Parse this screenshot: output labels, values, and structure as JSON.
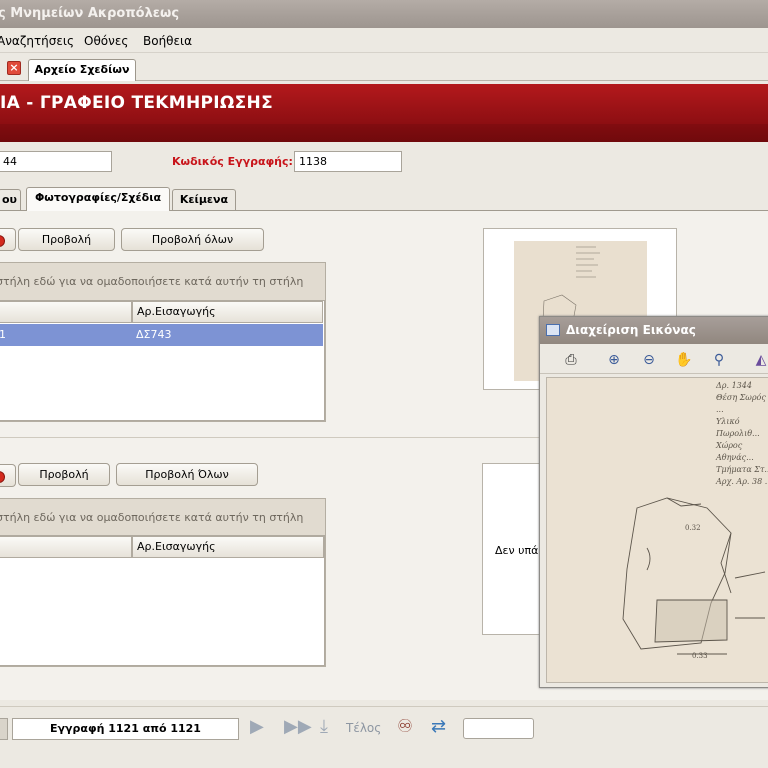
{
  "window": {
    "title": "ς Μνημείων Ακροπόλεως"
  },
  "menu": {
    "items": [
      "Αναζητήσεις",
      "Οθόνες",
      "Βοήθεια"
    ]
  },
  "doc_tab": {
    "label": "Αρχείο Σχεδίων"
  },
  "banner": {
    "title": "ΙΑ - ΓΡΑΦΕΙΟ ΤΕΚΜΗΡΙΩΣΗΣ"
  },
  "record": {
    "left_value": "44",
    "code_label": "Κωδικός Εγγραφής:",
    "code_value": "1138"
  },
  "tabs": [
    "ου",
    "Φωτογραφίες/Σχέδια",
    "Κείμενα"
  ],
  "photos": {
    "view_label": "Προβολή",
    "view_all_label": "Προβολή όλων",
    "group_hint": "στήλη εδώ για να ομαδοποιήσετε κατά αυτήν τη στήλη",
    "col_header": "Αρ.Εισαγωγής",
    "row_left": "1",
    "row_value": "ΔΣ743"
  },
  "drawings": {
    "view_label": "Προβολή",
    "view_all_label": "Προβολή Όλων",
    "group_hint": "στήλη εδώ για να ομαδοποιήσετε κατά αυτήν τη στήλη",
    "col_header": "Αρ.Εισαγωγής",
    "no_image_text": "Δεν υπάρ"
  },
  "navigator": {
    "record_text": "Εγγραφή 1121 από 1121",
    "end_label": "Τέλος"
  },
  "image_window": {
    "title": "Διαχείριση Εικόνας",
    "tools": [
      "printer-icon",
      "zoom-in-icon",
      "zoom-out-icon",
      "hand-pan-icon",
      "magnifier-icon",
      "more-icon"
    ],
    "sketch_notes": [
      "Δρ. 1344",
      "Θέση  Σωρός ...",
      "Υλικό  Πωρολιθ...",
      "Χώρος  Αθηνάς...",
      "Τμήματα  Στ...",
      "Αρχ. Αρ. 38 ..."
    ]
  },
  "colors": {
    "banner": "#9e1418",
    "selection": "#7d93d4",
    "label_red": "#c8141a"
  }
}
